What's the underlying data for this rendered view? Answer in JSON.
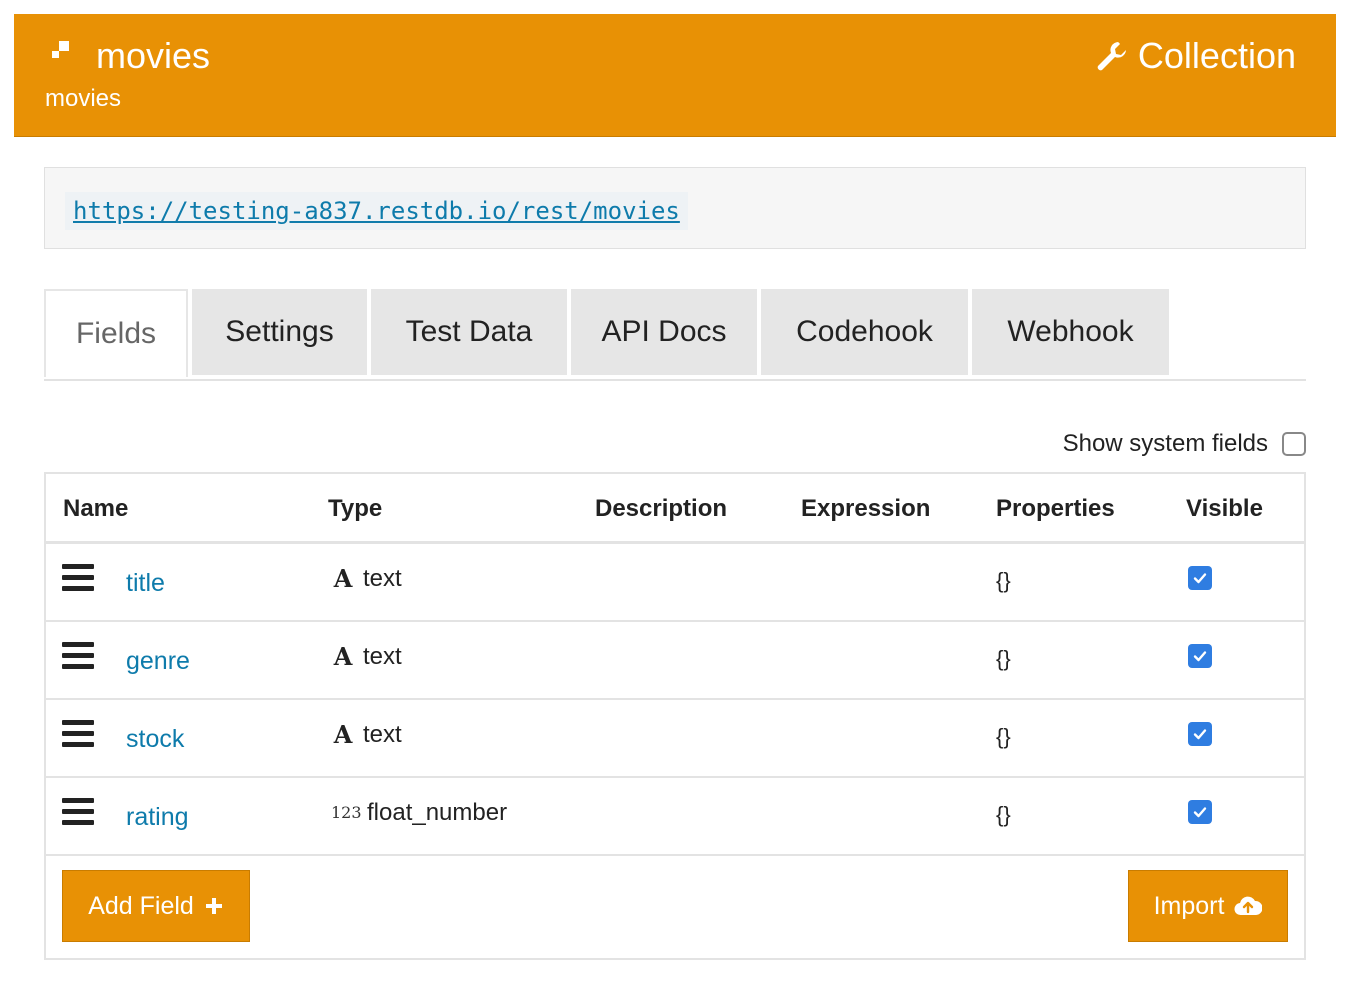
{
  "header": {
    "title": "movies",
    "subtitle": "movies",
    "collection_label": "Collection",
    "logo_icon": "collection-blocks-icon",
    "collection_icon": "wrench-icon",
    "color": "#e89105"
  },
  "url": "https://testing-a837.restdb.io/rest/movies",
  "tabs": [
    {
      "label": "Fields",
      "active": true
    },
    {
      "label": "Settings",
      "active": false
    },
    {
      "label": "Test Data",
      "active": false
    },
    {
      "label": "API Docs",
      "active": false
    },
    {
      "label": "Codehook",
      "active": false
    },
    {
      "label": "Webhook",
      "active": false
    }
  ],
  "show_system_fields": {
    "label": "Show system fields",
    "checked": false
  },
  "table": {
    "columns": [
      "Name",
      "Type",
      "Description",
      "Expression",
      "Properties",
      "Visible"
    ],
    "rows": [
      {
        "name": "title",
        "type_icon": "A",
        "type": "text",
        "description": "",
        "expression": "",
        "properties": "{}",
        "visible": true
      },
      {
        "name": "genre",
        "type_icon": "A",
        "type": "text",
        "description": "",
        "expression": "",
        "properties": "{}",
        "visible": true
      },
      {
        "name": "stock",
        "type_icon": "A",
        "type": "text",
        "description": "",
        "expression": "",
        "properties": "{}",
        "visible": true
      },
      {
        "name": "rating",
        "type_icon": "123",
        "type": "float_number",
        "description": "",
        "expression": "",
        "properties": "{}",
        "visible": true
      }
    ]
  },
  "buttons": {
    "add_field": "Add Field",
    "import": "Import"
  },
  "colors": {
    "accent": "#e89105",
    "link": "#0e7bab",
    "checkbox": "#2f7de1"
  }
}
